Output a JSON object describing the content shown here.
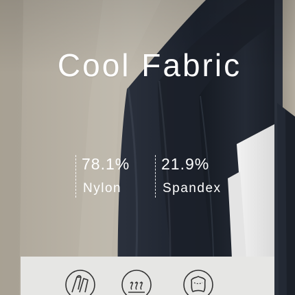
{
  "banner": {
    "title": "Cool Fabric"
  },
  "composition": [
    {
      "percent": "78.1%",
      "material": "Nylon"
    },
    {
      "percent": "21.9%",
      "material": "Spandex"
    }
  ],
  "features": [
    {
      "icon": "fabric-stretch-icon"
    },
    {
      "icon": "breathable-heat-icon"
    },
    {
      "icon": "soft-touch-icon"
    }
  ],
  "colors": {
    "beige_fabric": "#b9b2a6",
    "navy_fabric": "#1f2531",
    "strip": "#e6e6e4",
    "text": "#ffffff"
  }
}
